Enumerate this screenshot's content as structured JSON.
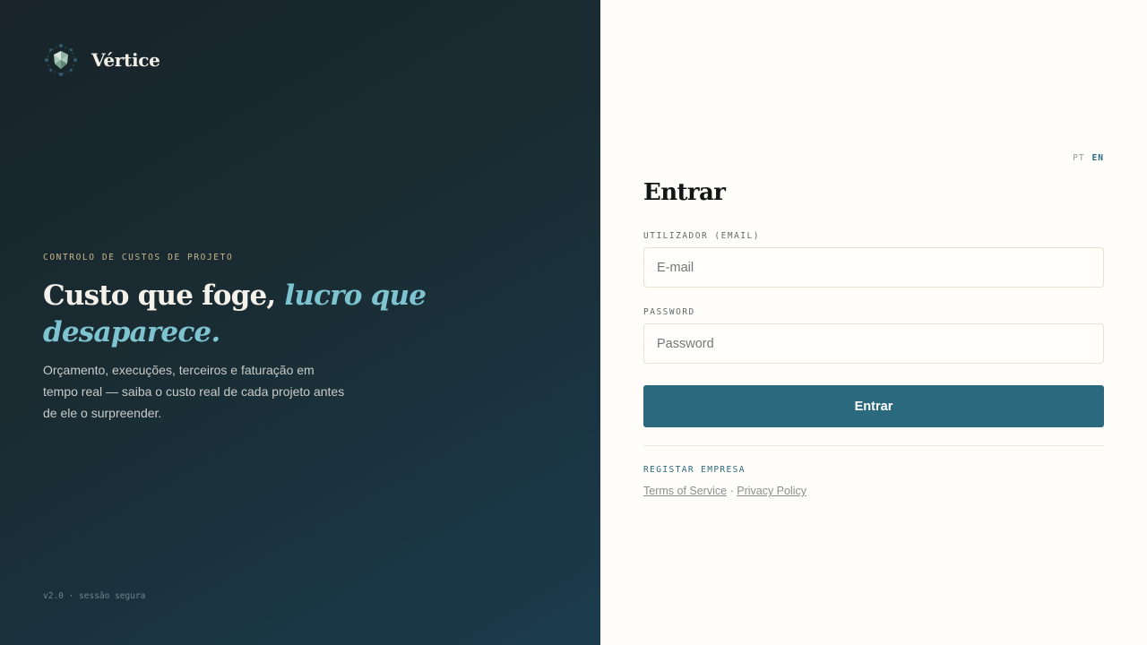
{
  "brand": {
    "name": "Vértice",
    "logo_icon": "geometric-gem-logo"
  },
  "hero": {
    "eyebrow": "CONTROLO DE CUSTOS DE PROJETO",
    "headline_plain": "Custo que foge, ",
    "headline_accent": "lucro que desaparece.",
    "lead": "Orçamento, execuções, terceiros e faturação em tempo real — saiba o custo real de cada projeto antes de ele o surpreender.",
    "footer_note": "v2.0 · sessão segura"
  },
  "language": {
    "pt": "PT",
    "en": "EN",
    "active": "EN"
  },
  "login": {
    "title": "Entrar",
    "user_label": "UTILIZADOR (EMAIL)",
    "user_placeholder": "E-mail",
    "user_value": "",
    "password_label": "PASSWORD",
    "password_placeholder": "Password",
    "password_value": "",
    "submit_label": "Entrar",
    "register_link": "REGISTAR EMPRESA",
    "terms_link": "Terms of Service",
    "separator": "·",
    "privacy_link": "Privacy Policy"
  },
  "colors": {
    "accent": "#2b6a7e",
    "accent_light": "#7ec4d0",
    "eyebrow": "#c8b58a",
    "dark_panel": "#1a2c33",
    "page_bg": "#fefdf9"
  }
}
